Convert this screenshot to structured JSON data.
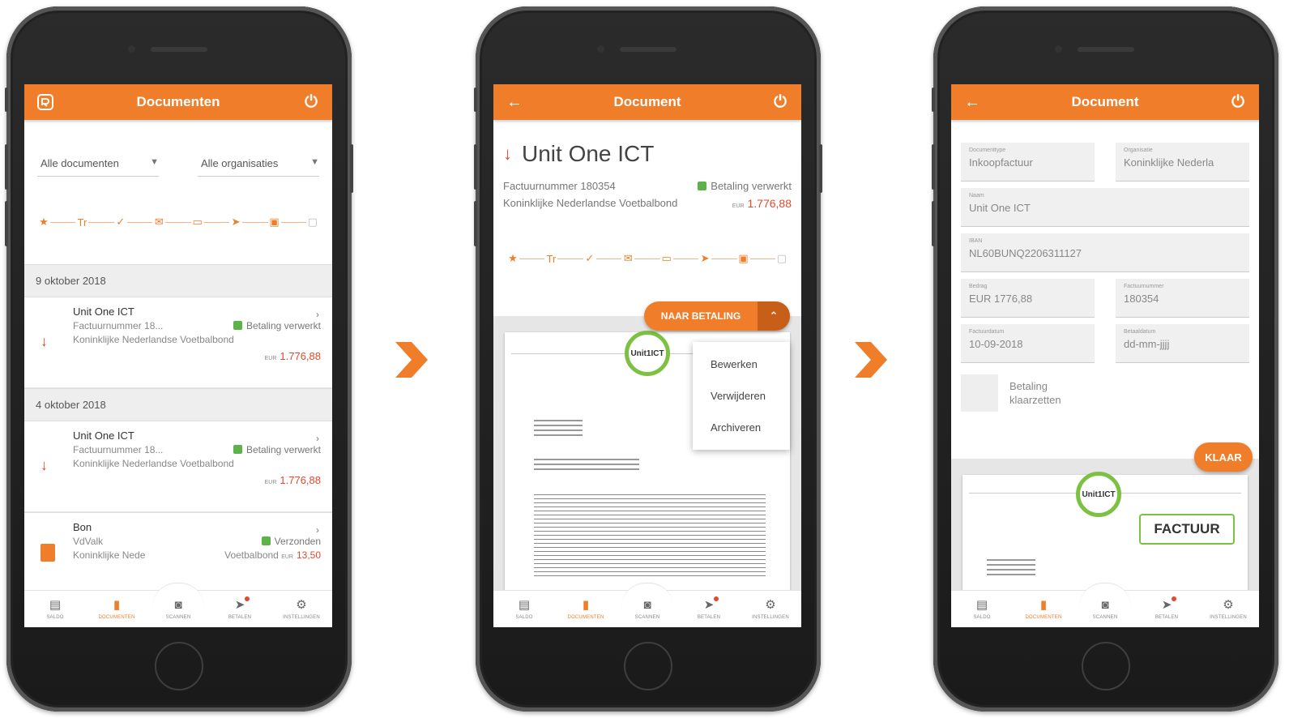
{
  "tabs": {
    "saldo": "SALDO",
    "documenten": "DOCUMENTEN",
    "scannen": "SCANNEN",
    "betalen": "BETALEN",
    "instellingen": "INSTELLINGEN"
  },
  "screen1": {
    "title": "Documenten",
    "filter_docs": "Alle documenten",
    "filter_orgs": "Alle organisaties",
    "sections": [
      {
        "date": "9 oktober 2018",
        "item": {
          "name": "Unit One ICT",
          "ref": "Factuurnummer 18...",
          "status": "Betaling verwerkt",
          "org": "Koninklijke Nederlandse Voetbalbond",
          "currency": "EUR",
          "amount": "1.776,88"
        }
      },
      {
        "date": "4 oktober 2018",
        "item": {
          "name": "Unit One ICT",
          "ref": "Factuurnummer 18...",
          "status": "Betaling verwerkt",
          "org": "Koninklijke Nederlandse Voetbalbond",
          "currency": "EUR",
          "amount": "1.776,88"
        }
      }
    ],
    "bon": {
      "name": "Bon",
      "ref": "VdValk",
      "status": "Verzonden",
      "org": "Koninklijke Nede",
      "org_tail": "Voetbalbond",
      "currency": "EUR",
      "amount": "13,50"
    }
  },
  "screen2": {
    "title": "Document",
    "doc_name": "Unit One ICT",
    "invoice": "Factuurnummer 180354",
    "status": "Betaling verwerkt",
    "org": "Koninklijke Nederlandse Voetbalbond",
    "currency": "EUR",
    "amount": "1.776,88",
    "pay_button": "NAAR BETALING",
    "menu": [
      "Bewerken",
      "Verwijderen",
      "Archiveren"
    ],
    "logo_text": "Unit1ICT"
  },
  "screen3": {
    "title": "Document",
    "fields": {
      "doctype_label": "Documenttype",
      "doctype": "Inkoopfactuur",
      "org_label": "Organisatie",
      "org": "Koninklijke Nederla",
      "name_label": "Naam",
      "name": "Unit One ICT",
      "iban_label": "IBAN",
      "iban": "NL60BUNQ2206311127",
      "amount_label": "Bedrag",
      "amount": "EUR 1776,88",
      "invoice_label": "Factuurnummer",
      "invoice": "180354",
      "invoice_date_label": "Factuurdatum",
      "invoice_date": "10-09-2018",
      "pay_date_label": "Betaaldatum",
      "pay_date": "dd-mm-jjjj"
    },
    "checkbox_label_1": "Betaling",
    "checkbox_label_2": "klaarzetten",
    "done_button": "KLAAR",
    "factuur": "FACTUUR",
    "logo_text": "Unit1ICT"
  },
  "colors": {
    "brand_orange": "#ef7d2a",
    "status_green": "#5db24a",
    "amount_red": "#e2492d"
  }
}
